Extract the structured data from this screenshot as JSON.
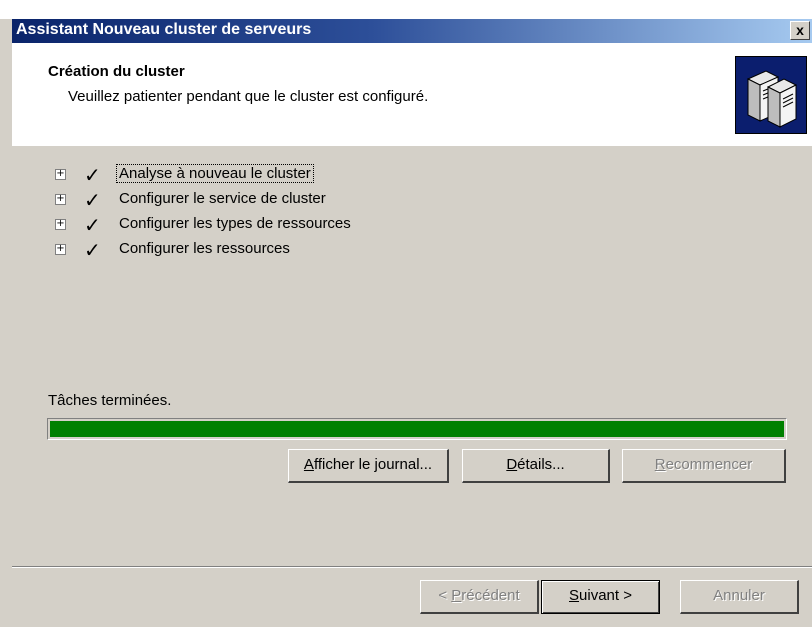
{
  "window": {
    "title": "Assistant Nouveau cluster de serveurs",
    "close_label": "x"
  },
  "header": {
    "title": "Création du cluster",
    "subtitle": "Veuillez patienter pendant que le cluster est configuré.",
    "icon": "cluster-servers-icon"
  },
  "tasks": [
    {
      "expander": "+",
      "status_icon": "checkmark-icon",
      "label": "Analyse à nouveau le cluster",
      "selected": true
    },
    {
      "expander": "+",
      "status_icon": "checkmark-icon",
      "label": "Configurer le service de cluster",
      "selected": false
    },
    {
      "expander": "+",
      "status_icon": "checkmark-icon",
      "label": "Configurer les types de ressources",
      "selected": false
    },
    {
      "expander": "+",
      "status_icon": "checkmark-icon",
      "label": "Configurer les ressources",
      "selected": false
    }
  ],
  "status": {
    "text": "Tâches terminées.",
    "progress_percent": 100,
    "progress_color": "#008000"
  },
  "actions": {
    "log": {
      "prefix": "",
      "mnemonic": "A",
      "suffix": "fficher le journal..."
    },
    "details": {
      "prefix": "",
      "mnemonic": "D",
      "suffix": "étails..."
    },
    "retry": {
      "prefix": "",
      "mnemonic": "R",
      "suffix": "ecommencer"
    }
  },
  "nav": {
    "back": {
      "prefix": "< ",
      "mnemonic": "P",
      "suffix": "récédent"
    },
    "next": {
      "prefix": "",
      "mnemonic": "S",
      "suffix": "uivant >"
    },
    "cancel": {
      "label": "Annuler"
    }
  }
}
